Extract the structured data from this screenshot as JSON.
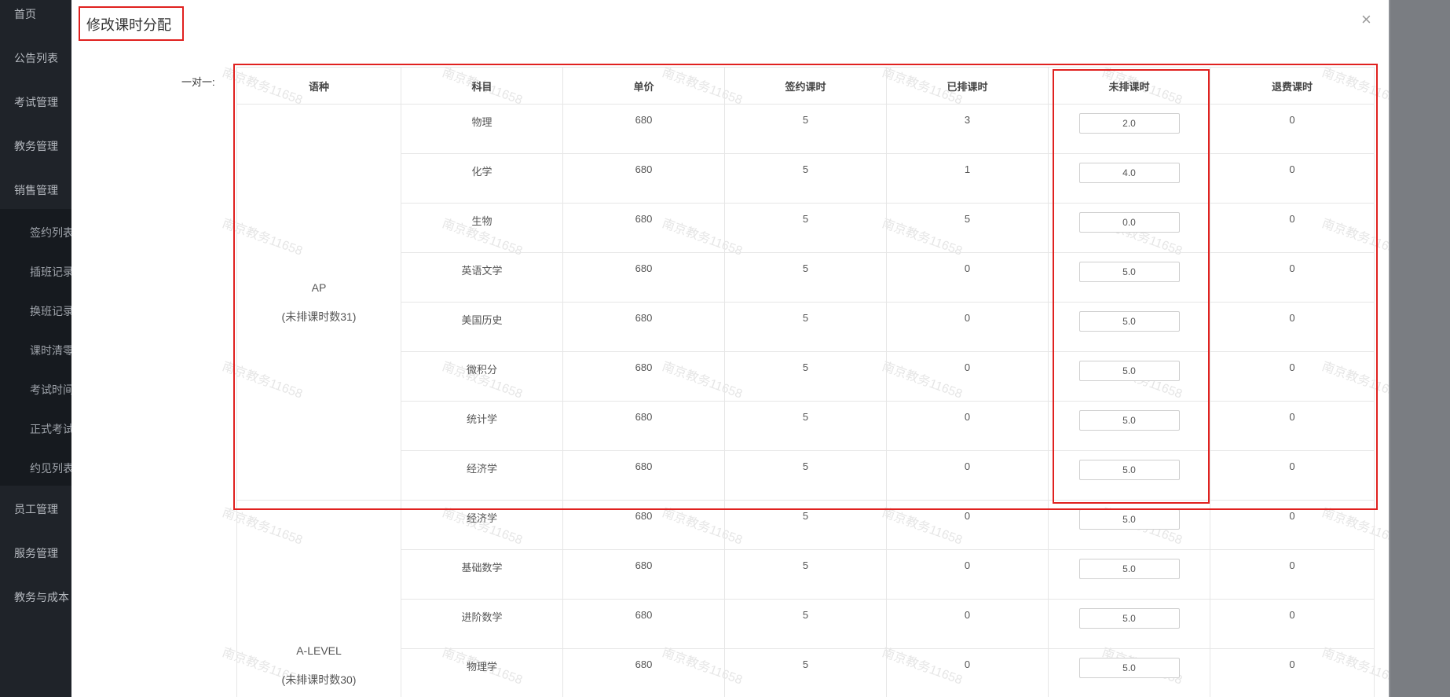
{
  "sidebar": {
    "items": [
      "首页",
      "公告列表",
      "考试管理",
      "教务管理",
      "销售管理",
      "员工管理",
      "服务管理",
      "教务与成本"
    ],
    "subitems": [
      "签约列表",
      "插班记录",
      "换班记录",
      "课时清零",
      "考试时间",
      "正式考试",
      "约见列表"
    ]
  },
  "modal": {
    "title": "修改课时分配",
    "close": "×",
    "row_label": "一对一:"
  },
  "table": {
    "headers": [
      "语种",
      "科目",
      "单价",
      "签约课时",
      "已排课时",
      "未排课时",
      "退费课时"
    ],
    "groups": [
      {
        "language": "AP",
        "note": "(未排课时数31)",
        "rows": [
          {
            "subject": "物理",
            "price": "680",
            "signed": "5",
            "scheduled": "3",
            "unscheduled": "2.0",
            "refund": "0"
          },
          {
            "subject": "化学",
            "price": "680",
            "signed": "5",
            "scheduled": "1",
            "unscheduled": "4.0",
            "refund": "0"
          },
          {
            "subject": "生物",
            "price": "680",
            "signed": "5",
            "scheduled": "5",
            "unscheduled": "0.0",
            "refund": "0"
          },
          {
            "subject": "英语文学",
            "price": "680",
            "signed": "5",
            "scheduled": "0",
            "unscheduled": "5.0",
            "refund": "0"
          },
          {
            "subject": "美国历史",
            "price": "680",
            "signed": "5",
            "scheduled": "0",
            "unscheduled": "5.0",
            "refund": "0"
          },
          {
            "subject": "微积分",
            "price": "680",
            "signed": "5",
            "scheduled": "0",
            "unscheduled": "5.0",
            "refund": "0"
          },
          {
            "subject": "统计学",
            "price": "680",
            "signed": "5",
            "scheduled": "0",
            "unscheduled": "5.0",
            "refund": "0"
          },
          {
            "subject": "经济学",
            "price": "680",
            "signed": "5",
            "scheduled": "0",
            "unscheduled": "5.0",
            "refund": "0"
          }
        ]
      },
      {
        "language": "A-LEVEL",
        "note": "(未排课时数30)",
        "rows": [
          {
            "subject": "经济学",
            "price": "680",
            "signed": "5",
            "scheduled": "0",
            "unscheduled": "5.0",
            "refund": "0"
          },
          {
            "subject": "基础数学",
            "price": "680",
            "signed": "5",
            "scheduled": "0",
            "unscheduled": "5.0",
            "refund": "0"
          },
          {
            "subject": "进阶数学",
            "price": "680",
            "signed": "5",
            "scheduled": "0",
            "unscheduled": "5.0",
            "refund": "0"
          },
          {
            "subject": "物理学",
            "price": "680",
            "signed": "5",
            "scheduled": "0",
            "unscheduled": "5.0",
            "refund": "0"
          }
        ]
      }
    ]
  },
  "watermark": "南京教务11658",
  "colors": {
    "highlight": "#e0211f",
    "sidebar": "#1f2329"
  }
}
